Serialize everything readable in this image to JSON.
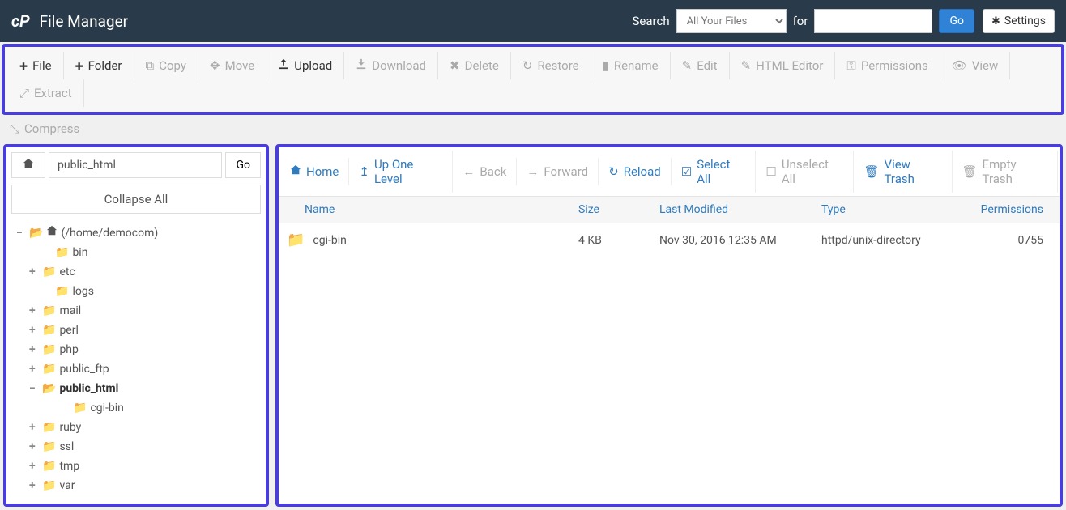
{
  "header": {
    "app_title": "File Manager",
    "search_label": "Search",
    "search_scope": "All Your Files",
    "for_label": "for",
    "search_value": "",
    "go_label": "Go",
    "settings_label": "Settings"
  },
  "toolbar": {
    "file": "File",
    "folder": "Folder",
    "copy": "Copy",
    "move": "Move",
    "upload": "Upload",
    "download": "Download",
    "delete": "Delete",
    "restore": "Restore",
    "rename": "Rename",
    "edit": "Edit",
    "html_editor": "HTML Editor",
    "permissions": "Permissions",
    "view": "View",
    "extract": "Extract",
    "compress": "Compress"
  },
  "sidebar": {
    "path_value": "public_html",
    "go_label": "Go",
    "collapse_all": "Collapse All",
    "tree": {
      "root": "(/home/democom)",
      "items": [
        {
          "label": "bin",
          "expandable": false
        },
        {
          "label": "etc",
          "expandable": true
        },
        {
          "label": "logs",
          "expandable": false
        },
        {
          "label": "mail",
          "expandable": true
        },
        {
          "label": "perl",
          "expandable": true
        },
        {
          "label": "php",
          "expandable": true
        },
        {
          "label": "public_ftp",
          "expandable": true
        },
        {
          "label": "public_html",
          "expandable": true,
          "selected": true,
          "expanded": true,
          "children": [
            {
              "label": "cgi-bin"
            }
          ]
        },
        {
          "label": "ruby",
          "expandable": true
        },
        {
          "label": "ssl",
          "expandable": true
        },
        {
          "label": "tmp",
          "expandable": true
        },
        {
          "label": "var",
          "expandable": true
        }
      ]
    }
  },
  "nav": {
    "home": "Home",
    "up": "Up One Level",
    "back": "Back",
    "forward": "Forward",
    "reload": "Reload",
    "select_all": "Select All",
    "unselect_all": "Unselect All",
    "view_trash": "View Trash",
    "empty_trash": "Empty Trash"
  },
  "table": {
    "columns": {
      "name": "Name",
      "size": "Size",
      "modified": "Last Modified",
      "type": "Type",
      "permissions": "Permissions"
    },
    "rows": [
      {
        "name": "cgi-bin",
        "size": "4 KB",
        "modified": "Nov 30, 2016 12:35 AM",
        "type": "httpd/unix-directory",
        "permissions": "0755"
      }
    ]
  }
}
